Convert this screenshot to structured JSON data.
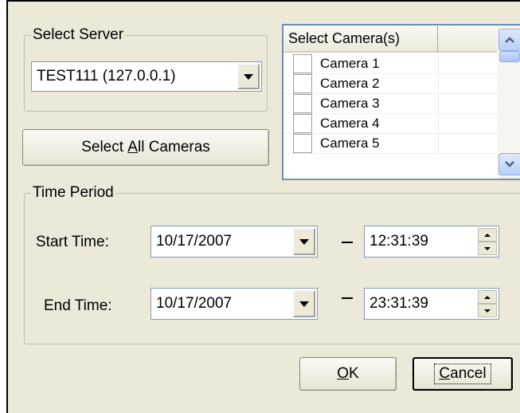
{
  "select_server": {
    "legend": "Select Server",
    "value": "TEST111 (127.0.0.1)"
  },
  "select_all": {
    "label_pre": "Select ",
    "label_mnemonic": "A",
    "label_post": "ll Cameras"
  },
  "camera_list": {
    "column_header": "Select Camera(s)",
    "items": [
      {
        "label": "Camera 1",
        "checked": false
      },
      {
        "label": "Camera 2",
        "checked": false
      },
      {
        "label": "Camera 3",
        "checked": false
      },
      {
        "label": "Camera 4",
        "checked": false
      },
      {
        "label": "Camera 5",
        "checked": false
      }
    ]
  },
  "time_period": {
    "legend": "Time Period",
    "start": {
      "label": "Start Time:",
      "date": "10/17/2007",
      "time": "12:31:39"
    },
    "end": {
      "label": "End Time:",
      "date": "10/17/2007",
      "time": "23:31:39"
    }
  },
  "buttons": {
    "ok_mnemonic": "O",
    "ok_rest": "K",
    "cancel_mnemonic": "C",
    "cancel_rest": "ancel"
  },
  "icons": {
    "dropdown": "chevron-down-icon",
    "scroll_up": "scroll-up-icon",
    "scroll_down": "scroll-down-icon",
    "spin": "spin-up-down-icon"
  }
}
